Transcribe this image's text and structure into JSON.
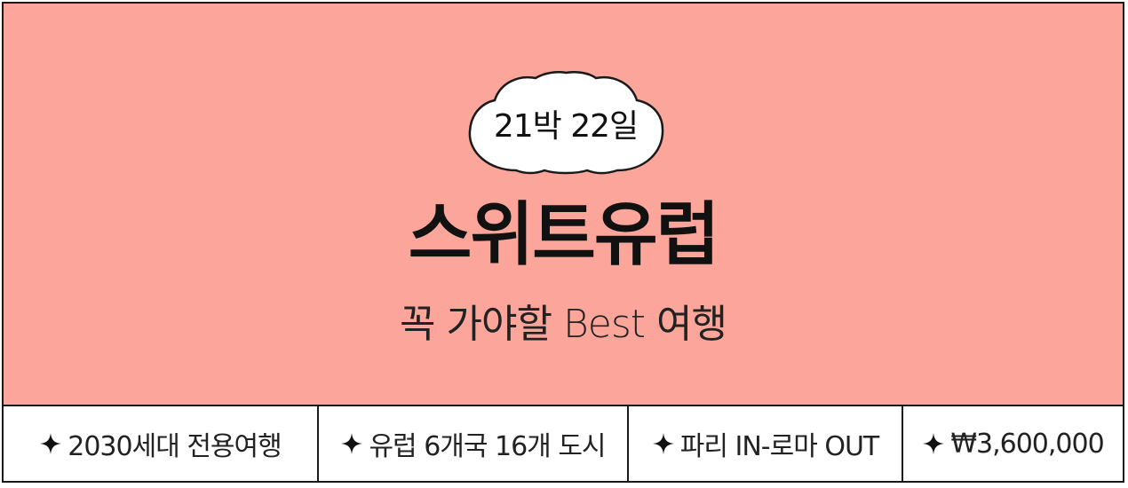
{
  "badge": {
    "label": "21박 22일",
    "shape": "cloud-icon"
  },
  "title": "스위트유럽",
  "subtitle": "꼭 가야할 Best 여행",
  "features": [
    {
      "icon": "sparkle-star-icon",
      "label": "2030세대 전용여행"
    },
    {
      "icon": "sparkle-star-icon",
      "label": "유럽 6개국 16개 도시"
    },
    {
      "icon": "sparkle-star-icon",
      "label": "파리 IN-로마 OUT"
    },
    {
      "icon": "sparkle-star-icon",
      "label": "₩3,600,000"
    }
  ],
  "colors": {
    "hero_background": "#fca69b",
    "border": "#1a1a1a",
    "badge_fill": "#ffffff",
    "text": "#111111"
  }
}
